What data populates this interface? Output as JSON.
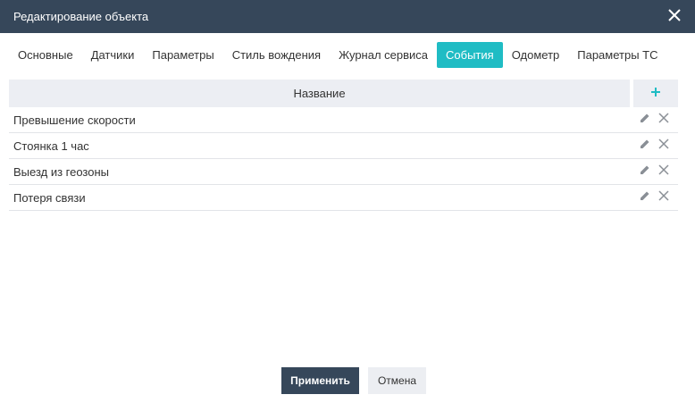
{
  "window": {
    "title": "Редактирование объекта",
    "close_icon": "close-icon"
  },
  "tabs": [
    {
      "label": "Основные",
      "active": false
    },
    {
      "label": "Датчики",
      "active": false
    },
    {
      "label": "Параметры",
      "active": false
    },
    {
      "label": "Стиль вождения",
      "active": false
    },
    {
      "label": "Журнал сервиса",
      "active": false
    },
    {
      "label": "События",
      "active": true
    },
    {
      "label": "Одометр",
      "active": false
    },
    {
      "label": "Параметры ТС",
      "active": false
    }
  ],
  "table": {
    "header_name": "Название",
    "add_icon": "plus-icon",
    "rows": [
      {
        "name": "Превышение скорости"
      },
      {
        "name": "Стоянка 1 час"
      },
      {
        "name": "Выезд из геозоны"
      },
      {
        "name": "Потеря связи"
      }
    ]
  },
  "footer": {
    "apply_label": "Применить",
    "cancel_label": "Отмена"
  },
  "colors": {
    "titlebar": "#36475a",
    "accent": "#1fbcc4",
    "header_bg": "#eceef3"
  }
}
